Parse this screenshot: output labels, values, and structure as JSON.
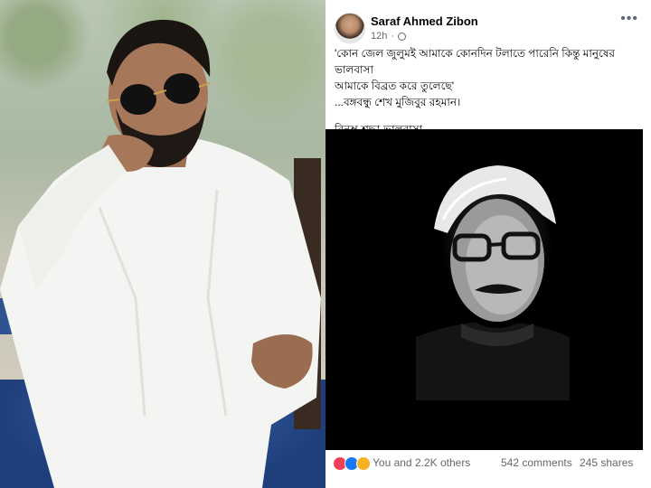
{
  "post": {
    "author": "Saraf Ahmed Zibon",
    "time": "12h",
    "more_icon": "more-horizontal-icon",
    "privacy_icon": "globe-icon",
    "quote_line1": "'কোন জেল জুলুমই আমাকে কোনদিন টলাতে পারেনি কিন্তু মানুষের ভালবাসা",
    "quote_line2": "আমাকে বিব্রত করে তুলেছে'",
    "attribution": "...বঙ্গবন্ধু শেখ মুজিবুর রহমান।",
    "closing": "বিনম্র শ্রদ্ধা-ভালবাসা...",
    "reactions_text": "You and 2.2K others",
    "comments": "542 comments",
    "shares": "245 shares",
    "reaction_icons": [
      "love-icon",
      "like-icon",
      "care-icon"
    ]
  },
  "colors": {
    "text": "#050505",
    "secondary": "#65676b",
    "image_bg": "#000000",
    "like": "#1877f2",
    "love": "#f33e58",
    "care": "#f7b125"
  }
}
